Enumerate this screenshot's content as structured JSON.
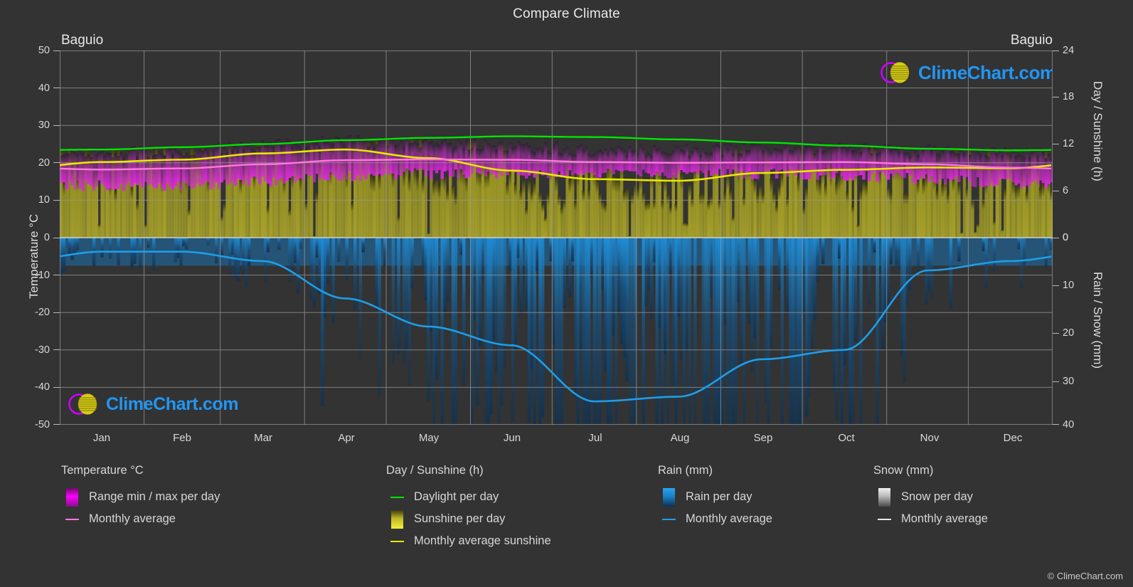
{
  "header": {
    "title": "Compare Climate",
    "city_left": "Baguio",
    "city_right": "Baguio"
  },
  "axes": {
    "left_title": "Temperature °C",
    "left_ticks": [
      "50",
      "40",
      "30",
      "20",
      "10",
      "0",
      "-10",
      "-20",
      "-30",
      "-40",
      "-50"
    ],
    "right_top_title": "Day / Sunshine (h)",
    "right_top_ticks": [
      "24",
      "18",
      "12",
      "6",
      "0"
    ],
    "right_bottom_title": "Rain / Snow (mm)",
    "right_bottom_ticks": [
      "0",
      "10",
      "20",
      "30",
      "40"
    ],
    "x_ticks": [
      "Jan",
      "Feb",
      "Mar",
      "Apr",
      "May",
      "Jun",
      "Jul",
      "Aug",
      "Sep",
      "Oct",
      "Nov",
      "Dec"
    ]
  },
  "legend": {
    "columns": [
      {
        "heading": "Temperature °C",
        "items": [
          {
            "label": "Range min / max per day",
            "key": "gradient",
            "color": "#ff00ff",
            "color2": "#5c0a5c"
          },
          {
            "label": "Monthly average",
            "key": "line",
            "color": "#ff77dd"
          }
        ]
      },
      {
        "heading": "Day / Sunshine (h)",
        "items": [
          {
            "label": "Daylight per day",
            "key": "line",
            "color": "#00e500"
          },
          {
            "label": "Sunshine per day",
            "key": "gradient",
            "color": "#f3f03a",
            "color2": "#3d3a10"
          },
          {
            "label": "Monthly average sunshine",
            "key": "line",
            "color": "#e8e800"
          }
        ]
      },
      {
        "heading": "Rain (mm)",
        "items": [
          {
            "label": "Rain per day",
            "key": "gradient",
            "color": "#1e9ee8",
            "color2": "#0b2f52"
          },
          {
            "label": "Monthly average",
            "key": "line",
            "color": "#1e9ee8"
          }
        ]
      },
      {
        "heading": "Snow (mm)",
        "items": [
          {
            "label": "Snow per day",
            "key": "gradient",
            "color": "#f2f2f2",
            "color2": "#4a4a4a"
          },
          {
            "label": "Monthly average",
            "key": "line",
            "color": "#e8e8e8"
          }
        ]
      }
    ],
    "copyright": "© ClimeChart.com"
  },
  "watermark": {
    "text": "ClimeChart.com"
  },
  "chart_data": {
    "type": "area",
    "title": "Compare Climate",
    "subtitle": "Baguio",
    "location": "Baguio",
    "xlabel": "",
    "ylabel": "Temperature °C",
    "ylim": [
      -50,
      50
    ],
    "y2_top_label": "Day / Sunshine (h)",
    "y2_top_lim": [
      0,
      24
    ],
    "y2_bottom_label": "Rain / Snow (mm)",
    "y2_bottom_lim": [
      0,
      40
    ],
    "grid": true,
    "categories": [
      "Jan",
      "Feb",
      "Mar",
      "Apr",
      "May",
      "Jun",
      "Jul",
      "Aug",
      "Sep",
      "Oct",
      "Nov",
      "Dec"
    ],
    "series": [
      {
        "name": "Monthly average temperature",
        "unit": "°C",
        "axis": "left",
        "color": "#ff77dd",
        "values": [
          18.2,
          18.5,
          19.6,
          20.7,
          20.9,
          20.8,
          20.2,
          20.0,
          20.1,
          20.2,
          19.6,
          18.7
        ]
      },
      {
        "name": "Range min per day",
        "unit": "°C",
        "axis": "left",
        "color": "#ff00ff",
        "values": [
          13.8,
          14.0,
          15.1,
          16.4,
          17.2,
          17.3,
          17.1,
          17.0,
          17.0,
          16.7,
          15.8,
          14.5
        ]
      },
      {
        "name": "Range max per day",
        "unit": "°C",
        "axis": "left",
        "color": "#ff00ff",
        "values": [
          22.6,
          23.4,
          24.8,
          25.9,
          25.4,
          24.6,
          23.6,
          23.4,
          23.8,
          23.9,
          23.3,
          22.6
        ]
      },
      {
        "name": "Daylight per day",
        "unit": "h",
        "axis": "right-top",
        "color": "#00e500",
        "values": [
          11.3,
          11.6,
          12.0,
          12.5,
          12.8,
          13.0,
          12.9,
          12.6,
          12.2,
          11.8,
          11.4,
          11.2
        ]
      },
      {
        "name": "Monthly average sunshine",
        "unit": "h",
        "axis": "right-top",
        "color": "#e8e800",
        "values": [
          9.7,
          10.0,
          10.8,
          11.3,
          10.2,
          8.6,
          7.5,
          7.3,
          8.3,
          8.7,
          9.0,
          8.9
        ]
      },
      {
        "name": "Monthly average rain",
        "unit": "mm",
        "axis": "right-bottom",
        "color": "#1e9ee8",
        "values": [
          3.0,
          3.0,
          5.0,
          13.0,
          19.0,
          23.0,
          35.0,
          34.0,
          26.0,
          24.0,
          7.0,
          5.0
        ]
      }
    ]
  }
}
